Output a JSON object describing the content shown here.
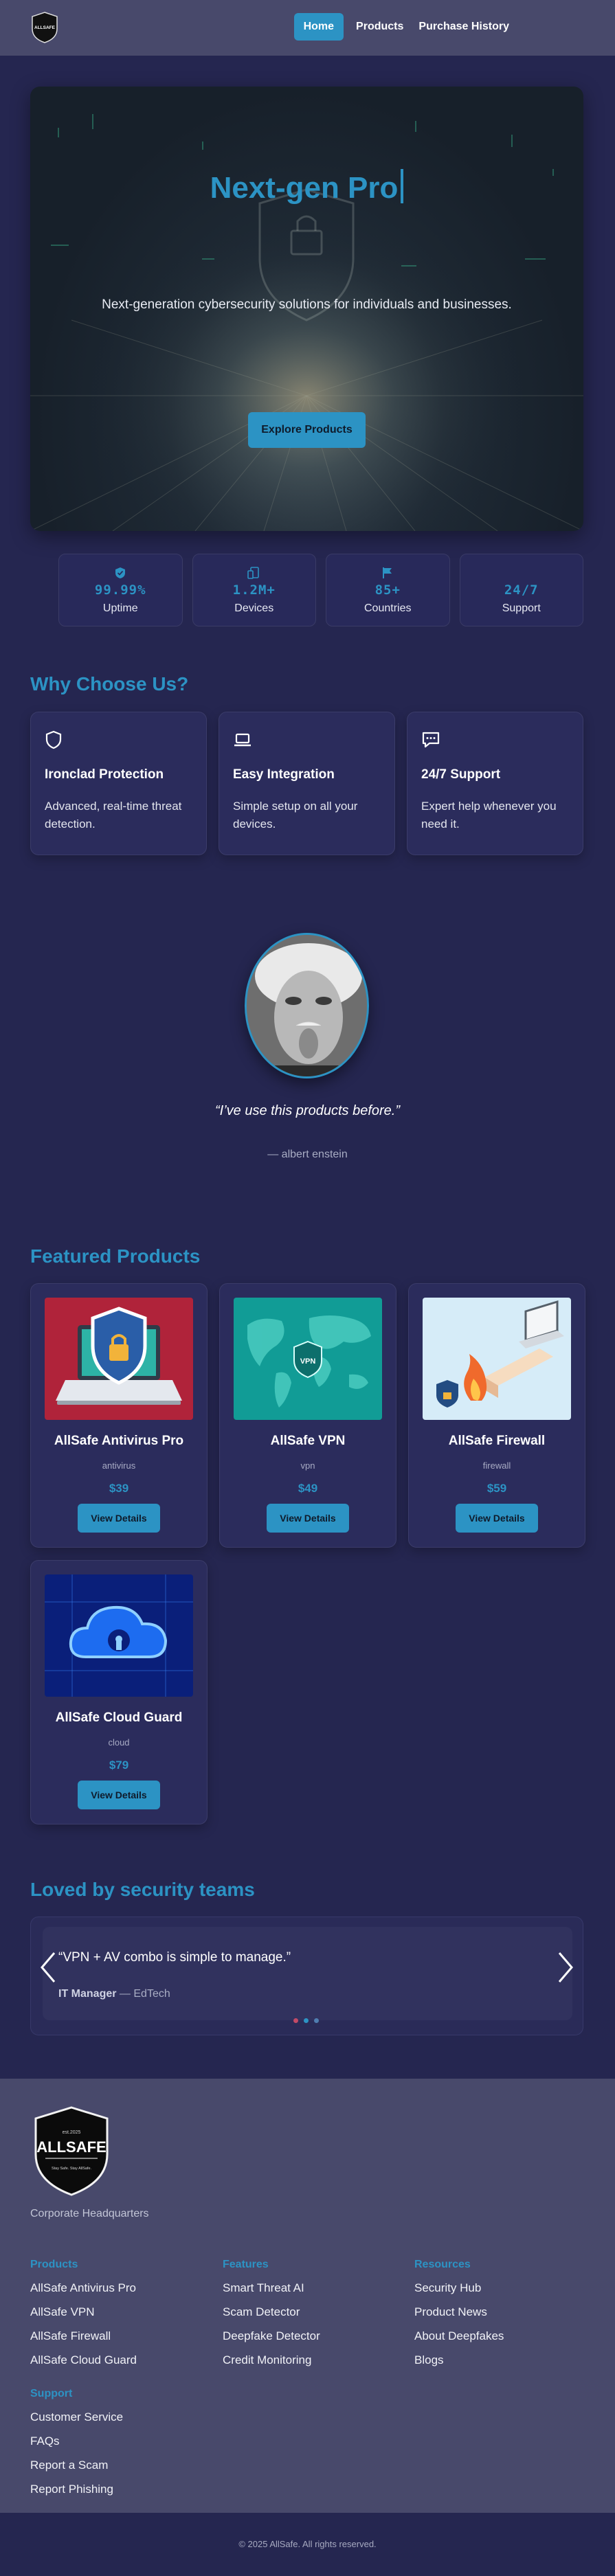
{
  "brand": {
    "logo_top": "est.2025",
    "logo_name": "ALLSAFE",
    "logo_tagline": "Stay Safe. Stay AllSafe."
  },
  "nav": {
    "items": [
      "Home",
      "Products",
      "Purchase History"
    ],
    "active": "Home"
  },
  "hero": {
    "title": "Next-gen Pro",
    "subtitle": "Next-generation cybersecurity solutions for individuals and businesses.",
    "cta": "Explore Products"
  },
  "stats": [
    {
      "icon": "shield-check-icon",
      "value": "99.99%",
      "label": "Uptime"
    },
    {
      "icon": "devices-icon",
      "value": "1.2M+",
      "label": "Devices"
    },
    {
      "icon": "flag-icon",
      "value": "85+",
      "label": "Countries"
    },
    {
      "icon": "",
      "value": "24/7",
      "label": "Support"
    }
  ],
  "why": {
    "heading": "Why Choose Us?",
    "features": [
      {
        "icon": "shield-icon",
        "title": "Ironclad Protection",
        "desc": "Advanced, real-time threat detection."
      },
      {
        "icon": "laptop-icon",
        "title": "Easy Integration",
        "desc": "Simple setup on all your devices."
      },
      {
        "icon": "chat-icon",
        "title": "24/7 Support",
        "desc": "Expert help whenever you need it."
      }
    ]
  },
  "testimonial_hero": {
    "quote": "“I’ve use this products before.”",
    "author": "— albert enstein"
  },
  "featured": {
    "heading": "Featured Products",
    "button_label": "View Details",
    "products": [
      {
        "name": "AllSafe Antivirus Pro",
        "category": "antivirus",
        "price": "$39",
        "image": "antivirus-laptop-shield"
      },
      {
        "name": "AllSafe VPN",
        "category": "vpn",
        "price": "$49",
        "image": "vpn-world-map"
      },
      {
        "name": "AllSafe Firewall",
        "category": "firewall",
        "price": "$59",
        "image": "firewall-wall-fire"
      },
      {
        "name": "AllSafe Cloud Guard",
        "category": "cloud",
        "price": "$79",
        "image": "cloud-lock"
      }
    ],
    "vpn_badge": "VPN"
  },
  "loved": {
    "heading": "Loved by security teams",
    "slide": {
      "text": "“VPN + AV combo is simple to manage.”",
      "author_role": "IT Manager",
      "author_org": "— EdTech"
    },
    "dots": 3,
    "active_dot": 1
  },
  "footer": {
    "hq": "Corporate Headquarters",
    "columns": [
      {
        "title": "Products",
        "items": [
          "AllSafe Antivirus Pro",
          "AllSafe VPN",
          "AllSafe Firewall",
          "AllSafe Cloud Guard"
        ]
      },
      {
        "title": "Features",
        "items": [
          "Smart Threat AI",
          "Scam Detector",
          "Deepfake Detector",
          "Credit Monitoring"
        ]
      },
      {
        "title": "Resources",
        "items": [
          "Security Hub",
          "Product News",
          "About Deepfakes",
          "Blogs"
        ]
      },
      {
        "title": "Support",
        "items": [
          "Customer Service",
          "FAQs",
          "Report a Scam",
          "Report Phishing"
        ]
      }
    ],
    "copyright": "© 2025 AllSafe. All rights reserved."
  },
  "colors": {
    "accent": "#2c93c4",
    "page_bg": "#252650",
    "nav_bg": "#48496b",
    "card_bg": "#2b2c5c"
  }
}
